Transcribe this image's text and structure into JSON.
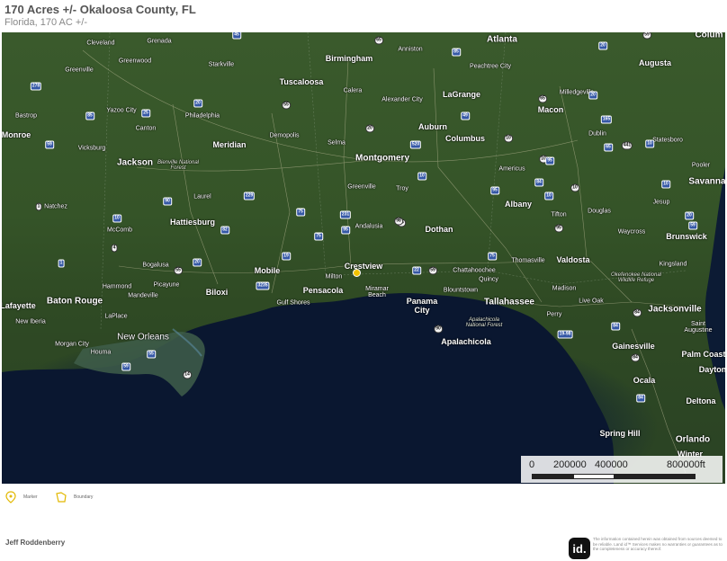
{
  "header": {
    "title": "170 Acres +/- Okaloosa County, FL",
    "subtitle": "Florida, 170 AC +/-"
  },
  "map": {
    "places": [
      {
        "name": "Cleveland",
        "kind": "town"
      },
      {
        "name": "Grenada",
        "kind": "town"
      },
      {
        "name": "Greenwood",
        "kind": "town"
      },
      {
        "name": "Starkville",
        "kind": "town"
      },
      {
        "name": "Birmingham",
        "kind": "city"
      },
      {
        "name": "Anniston",
        "kind": "town"
      },
      {
        "name": "Atlanta",
        "kind": "city"
      },
      {
        "name": "Colum",
        "kind": "city"
      },
      {
        "name": "Greenville",
        "kind": "town"
      },
      {
        "name": "Tuscaloosa",
        "kind": "city"
      },
      {
        "name": "Peachtree City",
        "kind": "town"
      },
      {
        "name": "Augusta",
        "kind": "city"
      },
      {
        "name": "Bastrop",
        "kind": "town"
      },
      {
        "name": "Yazoo City",
        "kind": "town"
      },
      {
        "name": "Philadelphia",
        "kind": "town"
      },
      {
        "name": "Calera",
        "kind": "town"
      },
      {
        "name": "Alexander City",
        "kind": "town"
      },
      {
        "name": "LaGrange",
        "kind": "city"
      },
      {
        "name": "Milledgeville",
        "kind": "town"
      },
      {
        "name": "Macon",
        "kind": "city"
      },
      {
        "name": "Canton",
        "kind": "town"
      },
      {
        "name": "Auburn",
        "kind": "city"
      },
      {
        "name": "Dublin",
        "kind": "town"
      },
      {
        "name": "Monroe",
        "kind": "city"
      },
      {
        "name": "Vicksburg",
        "kind": "town"
      },
      {
        "name": "Meridian",
        "kind": "city"
      },
      {
        "name": "Demopolis",
        "kind": "town"
      },
      {
        "name": "Selma",
        "kind": "town"
      },
      {
        "name": "Columbus",
        "kind": "city"
      },
      {
        "name": "Statesboro",
        "kind": "town"
      },
      {
        "name": "Jackson",
        "kind": "big"
      },
      {
        "name": "Bienville National Forest",
        "kind": "forest"
      },
      {
        "name": "Montgomery",
        "kind": "big"
      },
      {
        "name": "Americus",
        "kind": "town"
      },
      {
        "name": "Pooler",
        "kind": "town"
      },
      {
        "name": "Savanna",
        "kind": "big"
      },
      {
        "name": "Greenville",
        "kind": "town"
      },
      {
        "name": "Troy",
        "kind": "town"
      },
      {
        "name": "Laurel",
        "kind": "town"
      },
      {
        "name": "Albany",
        "kind": "city"
      },
      {
        "name": "Jesup",
        "kind": "town"
      },
      {
        "name": "Natchez",
        "kind": "town"
      },
      {
        "name": "Tifton",
        "kind": "town"
      },
      {
        "name": "Douglas",
        "kind": "town"
      },
      {
        "name": "Hattiesburg",
        "kind": "city"
      },
      {
        "name": "Andalusia",
        "kind": "town"
      },
      {
        "name": "Dothan",
        "kind": "city"
      },
      {
        "name": "McComb",
        "kind": "town"
      },
      {
        "name": "Waycross",
        "kind": "town"
      },
      {
        "name": "Brunswick",
        "kind": "city"
      },
      {
        "name": "Thomasville",
        "kind": "town"
      },
      {
        "name": "Valdosta",
        "kind": "city"
      },
      {
        "name": "Bogalusa",
        "kind": "town"
      },
      {
        "name": "Mobile",
        "kind": "city"
      },
      {
        "name": "Crestview",
        "kind": "city"
      },
      {
        "name": "Chattahoochee",
        "kind": "town"
      },
      {
        "name": "Kingsland",
        "kind": "town"
      },
      {
        "name": "Okefenokee National Wildlife Refuge",
        "kind": "forest"
      },
      {
        "name": "Hammond",
        "kind": "town"
      },
      {
        "name": "Picayune",
        "kind": "town"
      },
      {
        "name": "Milton",
        "kind": "town"
      },
      {
        "name": "Quincy",
        "kind": "town"
      },
      {
        "name": "Madison",
        "kind": "town"
      },
      {
        "name": "Mandeville",
        "kind": "town"
      },
      {
        "name": "Biloxi",
        "kind": "city"
      },
      {
        "name": "Pensacola",
        "kind": "city"
      },
      {
        "name": "Miramar Beach",
        "kind": "town"
      },
      {
        "name": "Blountstown",
        "kind": "town"
      },
      {
        "name": "Baton Rouge",
        "kind": "big"
      },
      {
        "name": "Panama City",
        "kind": "city"
      },
      {
        "name": "Tallahassee",
        "kind": "big"
      },
      {
        "name": "Live Oak",
        "kind": "town"
      },
      {
        "name": "Lafayette",
        "kind": "city"
      },
      {
        "name": "Gulf Shores",
        "kind": "town"
      },
      {
        "name": "Jacksonville",
        "kind": "big"
      },
      {
        "name": "LaPlace",
        "kind": "town"
      },
      {
        "name": "New Iberia",
        "kind": "town"
      },
      {
        "name": "Perry",
        "kind": "town"
      },
      {
        "name": "Apalachicola National Forest",
        "kind": "forest"
      },
      {
        "name": "Saint Augustine",
        "kind": "town"
      },
      {
        "name": "New Orleans",
        "kind": "bigthin"
      },
      {
        "name": "Apalachicola",
        "kind": "city"
      },
      {
        "name": "Morgan City",
        "kind": "town"
      },
      {
        "name": "Gainesville",
        "kind": "city"
      },
      {
        "name": "Palm Coast",
        "kind": "city"
      },
      {
        "name": "Houma",
        "kind": "town"
      },
      {
        "name": "Dayton",
        "kind": "city"
      },
      {
        "name": "Ocala",
        "kind": "city"
      },
      {
        "name": "Deltona",
        "kind": "city"
      },
      {
        "name": "Spring Hill",
        "kind": "city"
      },
      {
        "name": "Orlando",
        "kind": "big"
      },
      {
        "name": "Winter",
        "kind": "city"
      }
    ],
    "shields": [
      "45",
      "65",
      "85",
      "20",
      "59",
      "20",
      "278",
      "55",
      "25",
      "49",
      "65",
      "20",
      "85",
      "20",
      "520",
      "59",
      "10",
      "165",
      "10",
      "441",
      "95",
      "10",
      "10",
      "10",
      "10",
      "10",
      "231",
      "75",
      "95",
      "20",
      "19-98",
      "90",
      "10",
      "75",
      "95",
      "75",
      "95",
      "4",
      "1",
      "20",
      "55",
      "3235",
      "22",
      "59",
      "59",
      "55",
      "14",
      "59",
      "65",
      "84",
      "84",
      "84",
      "84",
      "95",
      "84",
      "98",
      "90",
      "229",
      "1",
      "19",
      "82",
      "17",
      "301",
      "27",
      "97"
    ],
    "marker_label": "Marker",
    "boundary_label": "Boundary"
  },
  "scale": {
    "ticks": [
      "0",
      "200000",
      "400000",
      "800000ft"
    ]
  },
  "legend": {
    "marker": "Marker",
    "boundary": "Boundary"
  },
  "footer": {
    "agent": "Jeff Roddenberry",
    "logo": "id.",
    "disclaimer": "The information contained herein was obtained from sources deemed to be reliable. Land id™ Services makes no warranties or guarantees as to the completeness or accuracy thereof."
  }
}
